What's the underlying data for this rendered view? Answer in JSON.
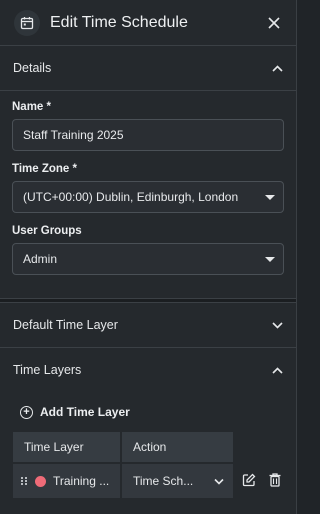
{
  "header": {
    "title": "Edit Time Schedule",
    "icon": "calendar-icon",
    "close_icon": "close-icon"
  },
  "details": {
    "section_label": "Details",
    "name": {
      "label": "Name *",
      "value": "Staff Training 2025"
    },
    "time_zone": {
      "label": "Time Zone *",
      "value": "(UTC+00:00) Dublin, Edinburgh, London"
    },
    "user_groups": {
      "label": "User Groups",
      "value": "Admin"
    }
  },
  "default_time_layer": {
    "section_label": "Default Time Layer"
  },
  "time_layers": {
    "section_label": "Time Layers",
    "add_label": "Add Time Layer",
    "columns": [
      "Time Layer",
      "Action"
    ],
    "rows": [
      {
        "name": "Training ...",
        "color": "#ef6b78",
        "action": "Time Sch..."
      }
    ]
  },
  "colors": {
    "background": "#202428",
    "panel": "#25292d",
    "accent_dot": "#ef6b78"
  }
}
